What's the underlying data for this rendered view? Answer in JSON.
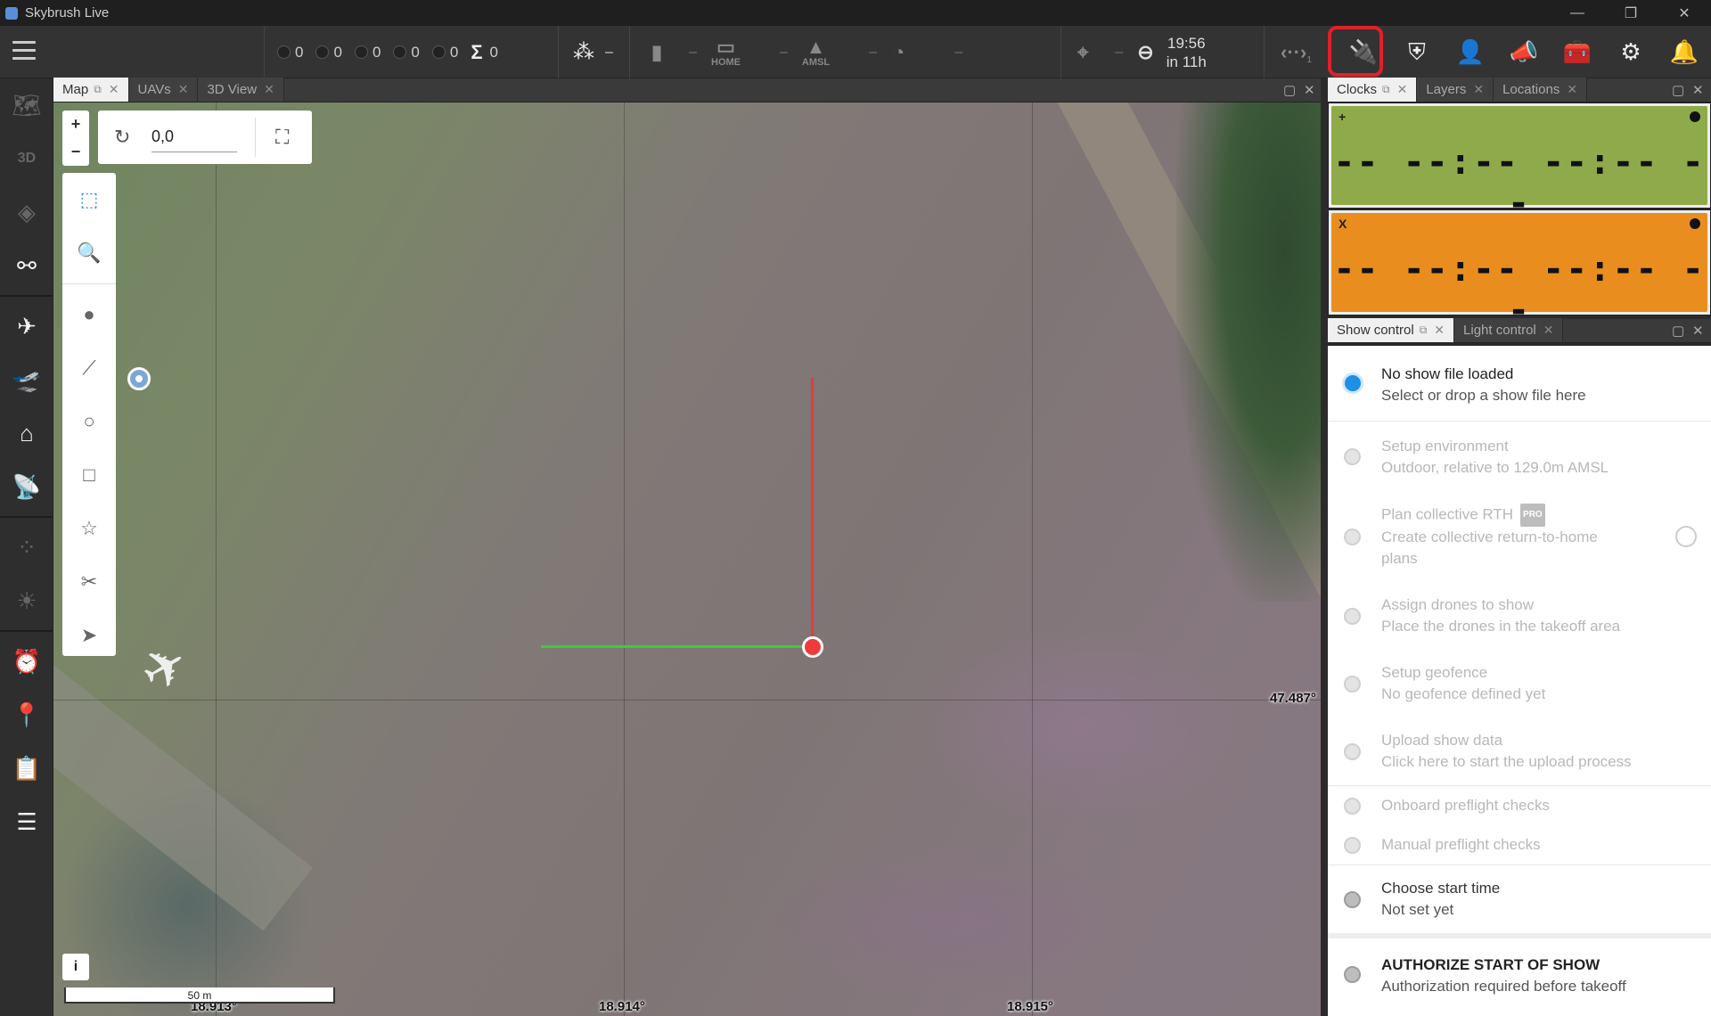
{
  "window": {
    "title": "Skybrush Live",
    "minimize": "—",
    "restore": "❐",
    "close": "✕"
  },
  "toolbar": {
    "counters": [
      "0",
      "0",
      "0",
      "0",
      "0"
    ],
    "sum_label": "Σ",
    "sum_value": "0",
    "drone_count": "–",
    "battery_value": "–",
    "home_label": "HOME",
    "home_value": "–",
    "amsl_label": "AMSL",
    "amsl_value": "–",
    "speed_value": "–",
    "gps_value": "–",
    "time": "19:56",
    "time_sub": "in 11h",
    "link_count": "1"
  },
  "sidebar": {
    "items": [
      "map",
      "3d",
      "layers",
      "geometry",
      "uavs",
      "takeoff",
      "home",
      "antenna",
      "swarm",
      "light",
      "clock",
      "location",
      "clipboard",
      "list"
    ]
  },
  "map_panel": {
    "tabs": [
      {
        "label": "Map",
        "active": true
      },
      {
        "label": "UAVs",
        "active": false
      },
      {
        "label": "3D View",
        "active": false
      }
    ],
    "rotation_value": "0,0",
    "lat_label": "47.487°",
    "lon_labels": [
      "18.913°",
      "18.914°",
      "18.915°"
    ],
    "scale_label": "50 m",
    "info_label": "i",
    "zoom_in": "+",
    "zoom_out": "−"
  },
  "clocks_panel": {
    "tabs": [
      {
        "label": "Clocks",
        "active": true
      },
      {
        "label": "Layers",
        "active": false
      },
      {
        "label": "Locations",
        "active": false
      }
    ],
    "clocks": [
      {
        "label": "+",
        "digits": "-- --:-- --:-- --",
        "color": "#8faa4a"
      },
      {
        "label": "X",
        "digits": "-- --:-- --:-- --",
        "color": "#e98e1e"
      }
    ]
  },
  "show_panel": {
    "tabs": [
      {
        "label": "Show control",
        "active": true
      },
      {
        "label": "Light control",
        "active": false
      }
    ],
    "steps": [
      {
        "title": "No show file loaded",
        "subtitle": "Select or drop a show file here",
        "state": "current"
      },
      {
        "title": "Setup environment",
        "subtitle": "Outdoor, relative to 129.0m AMSL",
        "state": "disabled"
      },
      {
        "title": "Plan collective RTH",
        "subtitle": "Create collective return-to-home plans",
        "state": "disabled",
        "badge": "PRO"
      },
      {
        "title": "Assign drones to show",
        "subtitle": "Place the drones in the takeoff area",
        "state": "disabled"
      },
      {
        "title": "Setup geofence",
        "subtitle": "No geofence defined yet",
        "state": "disabled"
      },
      {
        "title": "Upload show data",
        "subtitle": "Click here to start the upload process",
        "state": "disabled"
      },
      {
        "title": "Onboard preflight checks",
        "subtitle": "",
        "state": "disabled"
      },
      {
        "title": "Manual preflight checks",
        "subtitle": "",
        "state": "disabled"
      },
      {
        "title": "Choose start time",
        "subtitle": "Not set yet",
        "state": "dark"
      },
      {
        "title": "AUTHORIZE START OF SHOW",
        "subtitle": "Authorization required before takeoff",
        "state": "auth"
      }
    ]
  },
  "colors": {
    "accent": "#1e8fe6",
    "highlight": "#e0202a",
    "origin": "#ef3b3b",
    "x_axis": "#3acc3a",
    "y_axis": "#e63a3a"
  }
}
